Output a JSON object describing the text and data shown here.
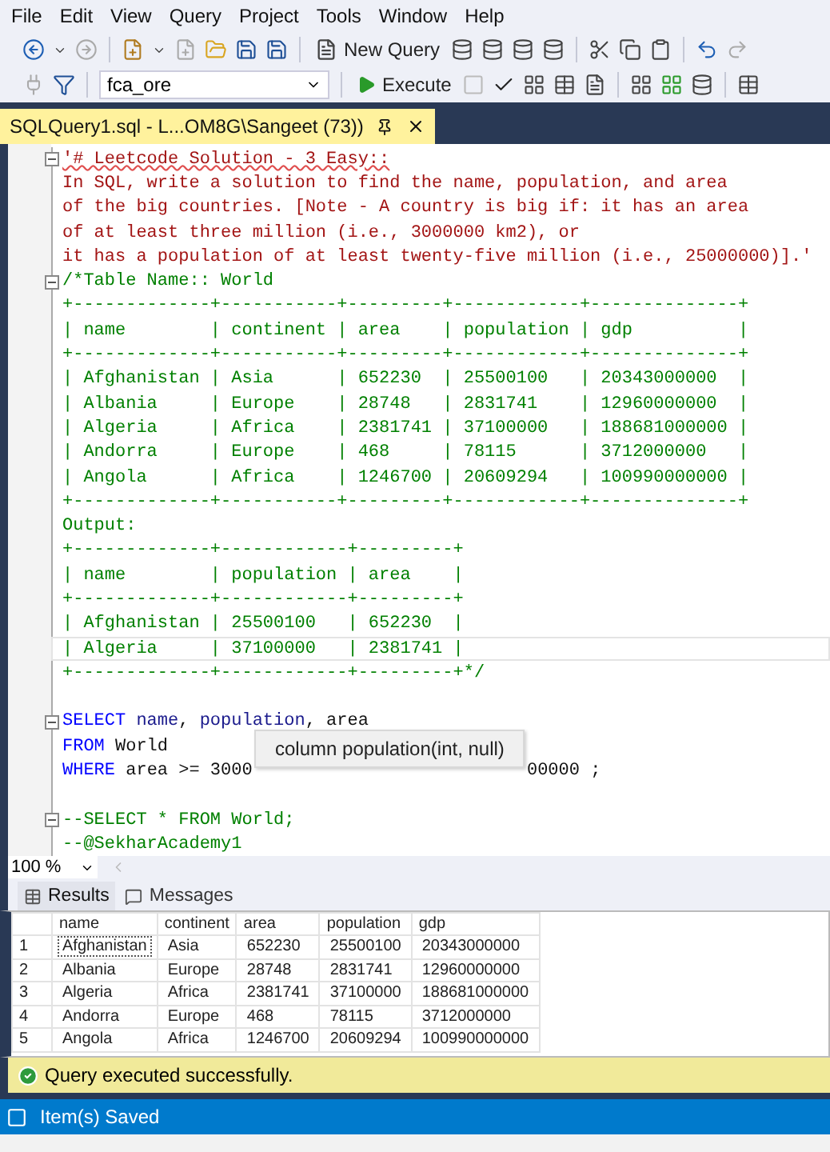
{
  "menu": [
    "File",
    "Edit",
    "View",
    "Query",
    "Project",
    "Tools",
    "Window",
    "Help"
  ],
  "toolbar": {
    "new_query": "New Query",
    "database": "fca_ore",
    "execute": "Execute"
  },
  "document_tab": {
    "title": "SQLQuery1.sql - L...OM8G\\Sangeet (73))",
    "selected": true
  },
  "editor": {
    "lines": [
      {
        "foldable": true,
        "current": false,
        "segments": [
          {
            "kind": "string_error",
            "text": "'# Leetcode Solution - 3 Easy::"
          }
        ]
      },
      {
        "foldable": false,
        "current": false,
        "segments": [
          {
            "kind": "string",
            "text": "In SQL, write a solution to find the name, population, and area"
          }
        ]
      },
      {
        "foldable": false,
        "current": false,
        "segments": [
          {
            "kind": "string",
            "text": "of the big countries. [Note - A country is big if: it has an area"
          }
        ]
      },
      {
        "foldable": false,
        "current": false,
        "segments": [
          {
            "kind": "string",
            "text": "of at least three million (i.e., 3000000 km2), or"
          }
        ]
      },
      {
        "foldable": false,
        "current": false,
        "segments": [
          {
            "kind": "string",
            "text": "it has a population of at least twenty-five million (i.e., 25000000)].'"
          }
        ]
      },
      {
        "foldable": true,
        "current": false,
        "segments": [
          {
            "kind": "comment",
            "text": "/*Table Name:: World"
          }
        ]
      },
      {
        "foldable": false,
        "current": false,
        "segments": [
          {
            "kind": "comment",
            "text": "+-------------+-----------+---------+------------+--------------+"
          }
        ]
      },
      {
        "foldable": false,
        "current": false,
        "segments": [
          {
            "kind": "comment",
            "text": "| name        | continent | area    | population | gdp          |"
          }
        ]
      },
      {
        "foldable": false,
        "current": false,
        "segments": [
          {
            "kind": "comment",
            "text": "+-------------+-----------+---------+------------+--------------+"
          }
        ]
      },
      {
        "foldable": false,
        "current": false,
        "segments": [
          {
            "kind": "comment",
            "text": "| Afghanistan | Asia      | 652230  | 25500100   | 20343000000  |"
          }
        ]
      },
      {
        "foldable": false,
        "current": false,
        "segments": [
          {
            "kind": "comment",
            "text": "| Albania     | Europe    | 28748   | 2831741    | 12960000000  |"
          }
        ]
      },
      {
        "foldable": false,
        "current": false,
        "segments": [
          {
            "kind": "comment",
            "text": "| Algeria     | Africa    | 2381741 | 37100000   | 188681000000 |"
          }
        ]
      },
      {
        "foldable": false,
        "current": false,
        "segments": [
          {
            "kind": "comment",
            "text": "| Andorra     | Europe    | 468     | 78115      | 3712000000   |"
          }
        ]
      },
      {
        "foldable": false,
        "current": false,
        "segments": [
          {
            "kind": "comment",
            "text": "| Angola      | Africa    | 1246700 | 20609294   | 100990000000 |"
          }
        ]
      },
      {
        "foldable": false,
        "current": false,
        "segments": [
          {
            "kind": "comment",
            "text": "+-------------+-----------+---------+------------+--------------+"
          }
        ]
      },
      {
        "foldable": false,
        "current": false,
        "segments": [
          {
            "kind": "comment",
            "text": "Output:"
          }
        ]
      },
      {
        "foldable": false,
        "current": false,
        "segments": [
          {
            "kind": "comment",
            "text": "+-------------+------------+---------+"
          }
        ]
      },
      {
        "foldable": false,
        "current": false,
        "segments": [
          {
            "kind": "comment",
            "text": "| name        | population | area    |"
          }
        ]
      },
      {
        "foldable": false,
        "current": false,
        "segments": [
          {
            "kind": "comment",
            "text": "+-------------+------------+---------+"
          }
        ]
      },
      {
        "foldable": false,
        "current": false,
        "segments": [
          {
            "kind": "comment",
            "text": "| Afghanistan | 25500100   | 652230  |"
          }
        ]
      },
      {
        "foldable": false,
        "current": true,
        "segments": [
          {
            "kind": "comment",
            "text": "| Algeria     | 37100000   | 2381741 |"
          }
        ]
      },
      {
        "foldable": false,
        "current": false,
        "segments": [
          {
            "kind": "comment",
            "text": "+-------------+------------+---------+*/"
          }
        ]
      },
      {
        "foldable": false,
        "current": false
      },
      {
        "foldable": true,
        "current": false,
        "segments": [
          {
            "kind": "keyword",
            "text": "SELECT"
          },
          {
            "kind": "column",
            "text": " name"
          },
          {
            "kind": "plain",
            "text": ", "
          },
          {
            "kind": "column",
            "text": "population"
          },
          {
            "kind": "plain",
            "text": ", area"
          }
        ]
      },
      {
        "foldable": false,
        "current": false,
        "segments": [
          {
            "kind": "keyword",
            "text": "FROM"
          },
          {
            "kind": "plain",
            "text": " World"
          }
        ]
      },
      {
        "foldable": false,
        "current": false,
        "segments": [
          {
            "kind": "keyword",
            "text": "WHERE"
          },
          {
            "kind": "plain",
            "text": " area >= 3000"
          },
          {
            "kind": "gap"
          },
          {
            "kind": "plain",
            "text": "00000 ;"
          }
        ]
      },
      {
        "foldable": false,
        "current": false
      },
      {
        "foldable": true,
        "current": false,
        "segments": [
          {
            "kind": "comment",
            "text": "--SELECT * FROM World;"
          }
        ]
      },
      {
        "foldable": false,
        "current": false,
        "segments": [
          {
            "kind": "comment",
            "text": "--@SekharAcademy1"
          }
        ]
      }
    ]
  },
  "tooltip": "column population(int, null)",
  "zoom": "100 %",
  "result_tabs": [
    {
      "label": "Results",
      "kind": "grid",
      "selected": true
    },
    {
      "label": "Messages",
      "kind": "messages",
      "selected": false
    }
  ],
  "results": {
    "columns": [
      "name",
      "continent",
      "area",
      "population",
      "gdp"
    ],
    "rows": [
      {
        "number": "1",
        "selected": true,
        "cells": [
          "Afghanistan",
          "Asia",
          "652230",
          "25500100",
          "20343000000"
        ]
      },
      {
        "number": "2",
        "selected": false,
        "cells": [
          "Albania",
          "Europe",
          "28748",
          "2831741",
          "12960000000"
        ]
      },
      {
        "number": "3",
        "selected": false,
        "cells": [
          "Algeria",
          "Africa",
          "2381741",
          "37100000",
          "188681000000"
        ]
      },
      {
        "number": "4",
        "selected": false,
        "cells": [
          "Andorra",
          "Europe",
          "468",
          "78115",
          "3712000000"
        ]
      },
      {
        "number": "5",
        "selected": false,
        "cells": [
          "Angola",
          "Africa",
          "1246700",
          "20609294",
          "100990000000"
        ]
      }
    ]
  },
  "query_status": "Query executed successfully.",
  "status_bar": "Item(s) Saved"
}
